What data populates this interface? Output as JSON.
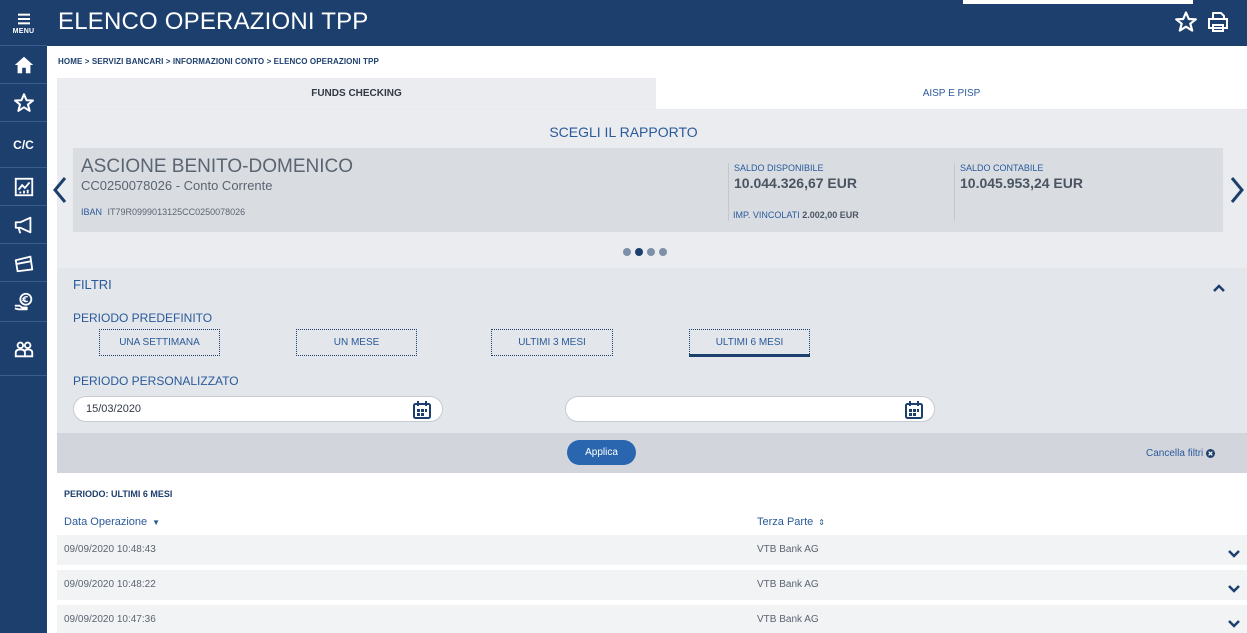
{
  "header": {
    "title": "ELENCO OPERAZIONI TPP"
  },
  "rail": {
    "menu_label": "MENU",
    "cc_label": "C/C"
  },
  "breadcrumb": "HOME > SERVIZI BANCARI > INFORMAZIONI CONTO > ELENCO OPERAZIONI TPP",
  "tabs": [
    {
      "label": "FUNDS CHECKING",
      "active": true
    },
    {
      "label": "AISP E PISP",
      "active": false
    }
  ],
  "carousel": {
    "title": "SCEGLI IL RAPPORTO",
    "account": {
      "holder": "ASCIONE BENITO-DOMENICO",
      "number": "CC0250078026 - Conto Corrente",
      "iban_label": "IBAN",
      "iban": "IT79R0999013125CC0250078026",
      "available_label": "SALDO DISPONIBILE",
      "available": "10.044.326,67 EUR",
      "accounting_label": "SALDO CONTABILE",
      "accounting": "10.045.953,24 EUR",
      "bound_label": "IMP. VINCOLATI",
      "bound": "2.002,00 EUR"
    },
    "dots": 4,
    "active_dot": 1
  },
  "filters": {
    "title": "FILTRI",
    "predefined_label": "PERIODO PREDEFINITO",
    "periods": [
      "UNA SETTIMANA",
      "UN MESE",
      "ULTIMI 3 MESI",
      "ULTIMI 6 MESI"
    ],
    "selected_period": "ULTIMI 6 MESI",
    "custom_label": "PERIODO PERSONALIZZATO",
    "date_from": "15/03/2020",
    "date_to": "",
    "apply_label": "Applica",
    "clear_label": "Cancella filtri"
  },
  "results": {
    "period_label": "PERIODO: ULTIMI 6 MESI",
    "columns": {
      "date": "Data Operazione",
      "party": "Terza Parte"
    },
    "rows": [
      {
        "date": "09/09/2020 10:48:43",
        "party": "VTB Bank AG"
      },
      {
        "date": "09/09/2020 10:48:22",
        "party": "VTB Bank AG"
      },
      {
        "date": "09/09/2020 10:47:36",
        "party": "VTB Bank AG"
      }
    ]
  },
  "colors": {
    "navy": "#1d3f6e",
    "link_blue": "#2a5a9a",
    "button_blue": "#2a66b0"
  }
}
